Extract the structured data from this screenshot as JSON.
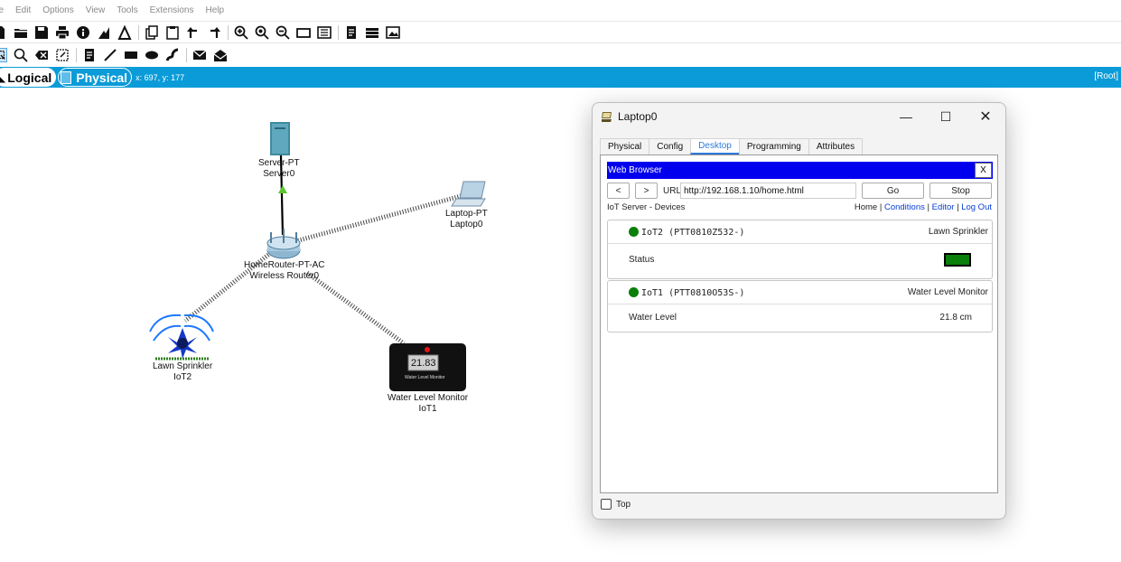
{
  "menu": [
    "ile",
    "Edit",
    "Options",
    "View",
    "Tools",
    "Extensions",
    "Help"
  ],
  "toolbar_icons_row1": [
    "new-file-icon",
    "open-folder-icon",
    "save-icon",
    "print-icon",
    "info-icon",
    "activity-wizard-icon",
    "wireless-icon",
    "copy-icon",
    "paste-icon",
    "undo-icon",
    "redo-icon",
    "zoom-in-icon",
    "zoom-reset-icon",
    "zoom-out-icon",
    "rectangle-icon",
    "palette-icon",
    "notes-icon",
    "network-info-icon",
    "screenshot-icon"
  ],
  "toolbar_icons_row2": [
    "select-icon",
    "inspect-icon",
    "delete-icon",
    "resize-icon",
    "note-icon",
    "line-icon",
    "rectangle-shape-icon",
    "ellipse-icon",
    "freeform-icon",
    "add-simple-pdu-icon",
    "add-complex-pdu-icon"
  ],
  "mode": {
    "logical": "Logical",
    "physical": "Physical",
    "coords": "x: 697, y: 177",
    "root": "[Root]"
  },
  "devices": {
    "server": {
      "line1": "Server-PT",
      "line2": "Server0"
    },
    "router": {
      "line1": "HomeRouter-PT-AC",
      "line2": "Wireless Router0"
    },
    "laptop": {
      "line1": "Laptop-PT",
      "line2": "Laptop0"
    },
    "sprinkler": {
      "line1": "Lawn Sprinkler",
      "line2": "IoT2"
    },
    "monitor": {
      "line1": "Water Level Monitor",
      "line2": "IoT1",
      "display": "21.83",
      "caption": "Water Level Monitor"
    }
  },
  "window": {
    "title": "Laptop0",
    "minimize": "—",
    "maximize": "☐",
    "close": "✕",
    "tabs": [
      "Physical",
      "Config",
      "Desktop",
      "Programming",
      "Attributes"
    ],
    "active_tab": "Desktop",
    "browser": {
      "title": "Web Browser",
      "close": "X",
      "back": "<",
      "forward": ">",
      "url_label": "URL",
      "url": "http://192.168.1.10/home.html",
      "go": "Go",
      "stop": "Stop",
      "site_title": "IoT Server - Devices",
      "nav": {
        "home": "Home",
        "sep": "|",
        "conditions": "Conditions",
        "editor": "Editor",
        "logout": "Log Out"
      },
      "devices": [
        {
          "id": "IoT2 (PTT0810Z532-)",
          "type": "Lawn Sprinkler",
          "row_label": "Status",
          "status_color": "#0a7f0a"
        },
        {
          "id": "IoT1 (PTT0810O53S-)",
          "type": "Water Level Monitor",
          "row_label": "Water Level",
          "row_value": "21.8 cm"
        }
      ]
    },
    "top_checkbox": "Top"
  }
}
